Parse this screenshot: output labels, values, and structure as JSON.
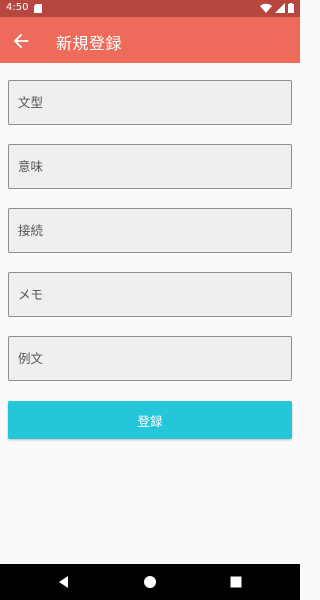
{
  "status_bar": {
    "time": "4:50",
    "icons": [
      "sd-card-icon",
      "wifi-icon",
      "signal-icon",
      "battery-icon"
    ]
  },
  "app_bar": {
    "title": "新規登録",
    "back_icon": "arrow-left-icon",
    "color": "#ee6b5c"
  },
  "form": {
    "fields": [
      {
        "placeholder": "文型",
        "value": ""
      },
      {
        "placeholder": "意味",
        "value": ""
      },
      {
        "placeholder": "接続",
        "value": ""
      },
      {
        "placeholder": "メモ",
        "value": ""
      },
      {
        "placeholder": "例文",
        "value": ""
      }
    ],
    "submit_label": "登録",
    "submit_color": "#26c6da"
  },
  "nav_bar": {
    "icons": [
      "back-triangle-icon",
      "home-circle-icon",
      "recents-square-icon"
    ]
  }
}
